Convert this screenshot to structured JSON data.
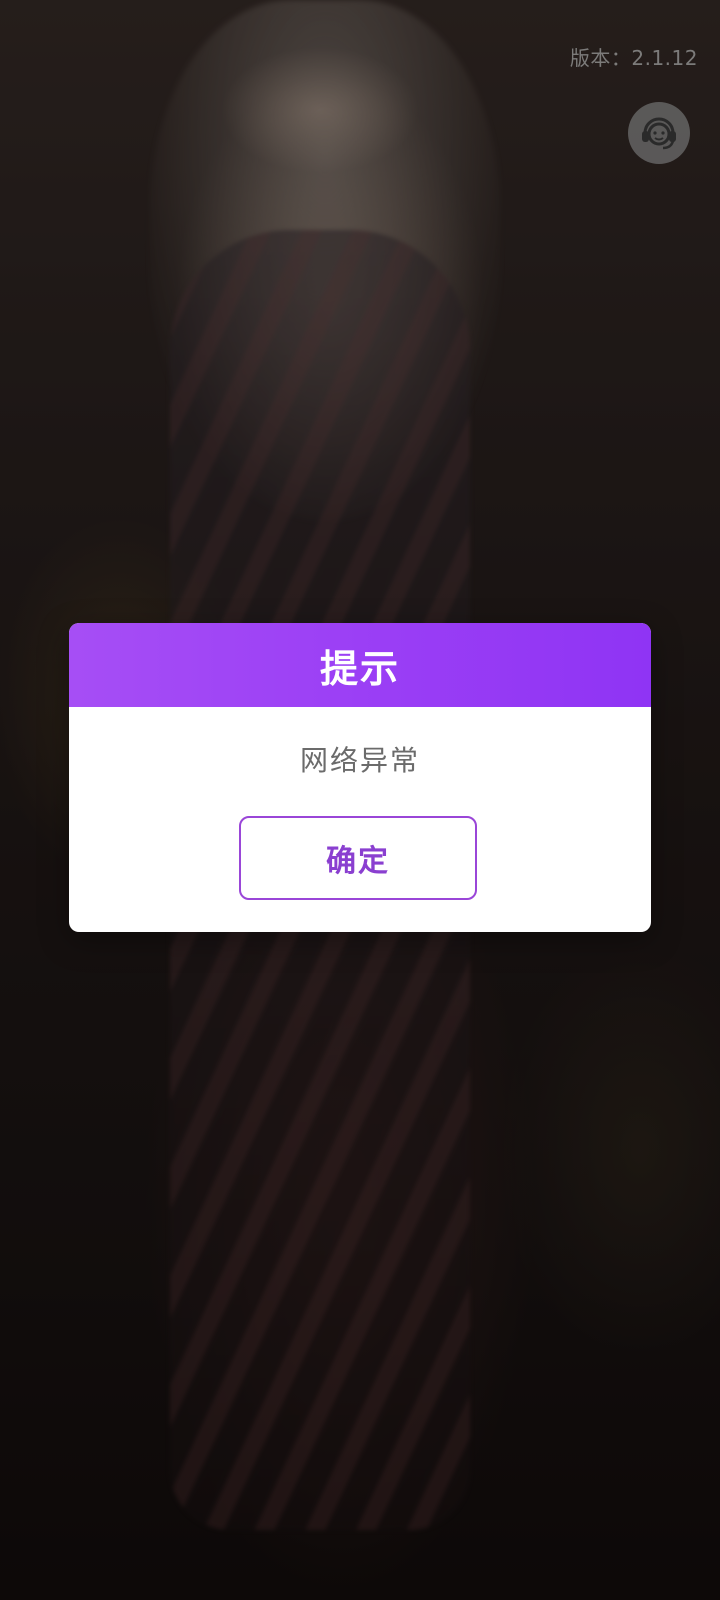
{
  "app": {
    "version_text": "版本：2.1.12",
    "support_icon": "customer-service-icon"
  },
  "dialog": {
    "title": "提示",
    "message": "网络异常",
    "confirm_label": "确定"
  },
  "colors": {
    "header_gradient_start": "#a64ef5",
    "header_gradient_end": "#8f34f4",
    "button_border": "#9a46d8",
    "button_text": "#8a3fd0",
    "message_text": "#6b6b6b"
  }
}
